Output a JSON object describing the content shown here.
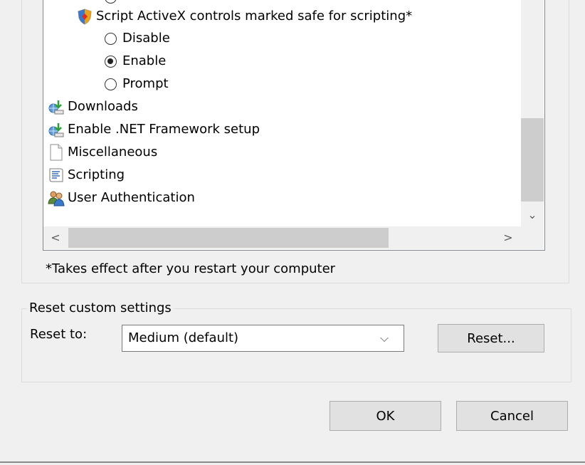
{
  "settings_list": {
    "items": [
      {
        "kind": "setting",
        "icon": "activex-shield-icon",
        "label": "Script ActiveX controls marked safe for scripting*"
      },
      {
        "kind": "option",
        "label": "Disable",
        "checked": false
      },
      {
        "kind": "option",
        "label": "Enable",
        "checked": true
      },
      {
        "kind": "option",
        "label": "Prompt",
        "checked": false
      },
      {
        "kind": "category",
        "icon": "downloads-icon",
        "label": "Downloads"
      },
      {
        "kind": "category",
        "icon": "net-framework-icon",
        "label": "Enable .NET Framework setup"
      },
      {
        "kind": "category",
        "icon": "document-icon",
        "label": "Miscellaneous"
      },
      {
        "kind": "category",
        "icon": "scripting-icon",
        "label": "Scripting"
      },
      {
        "kind": "category",
        "icon": "users-icon",
        "label": "User Authentication"
      }
    ]
  },
  "note": "*Takes effect after you restart your computer",
  "reset_group": {
    "title": "Reset custom settings",
    "reset_to_label": "Reset to:",
    "selected_level": "Medium (default)",
    "reset_button": "Reset..."
  },
  "dialog_buttons": {
    "ok": "OK",
    "cancel": "Cancel"
  },
  "colors": {
    "window_bg": "#f0f0f0",
    "list_bg": "#ffffff",
    "button_bg": "#e1e1e1"
  }
}
